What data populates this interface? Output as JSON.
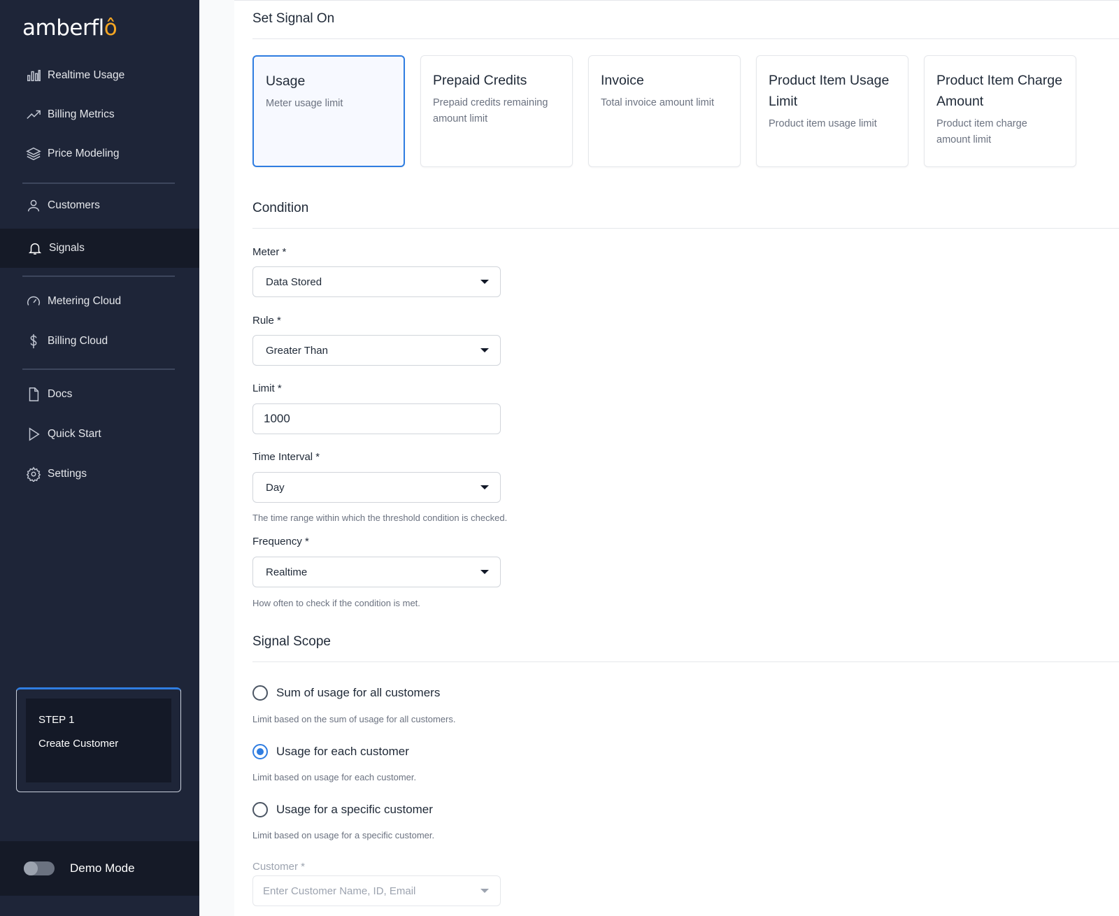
{
  "brand": {
    "logo_text_a": "amberfl",
    "logo_text_b": "ô",
    "accent": "#2f7de1",
    "logo_accent": "#f5a623"
  },
  "sidebar": {
    "items": [
      {
        "label": "Realtime Usage",
        "icon": "bar-chart-icon"
      },
      {
        "label": "Billing Metrics",
        "icon": "trend-line-icon"
      },
      {
        "label": "Price Modeling",
        "icon": "layers-icon"
      },
      {
        "label": "Customers",
        "icon": "user-icon"
      },
      {
        "label": "Signals",
        "icon": "bell-icon",
        "active": true
      },
      {
        "label": "Metering Cloud",
        "icon": "gauge-icon"
      },
      {
        "label": "Billing Cloud",
        "icon": "dollar-icon"
      },
      {
        "label": "Docs",
        "icon": "document-icon"
      },
      {
        "label": "Quick Start",
        "icon": "play-icon"
      },
      {
        "label": "Settings",
        "icon": "gear-icon"
      }
    ],
    "step": {
      "title": "STEP 1",
      "subtitle": "Create Customer"
    },
    "demo_mode": {
      "label": "Demo Mode",
      "enabled": false
    }
  },
  "form": {
    "set_signal_title": "Set Signal On",
    "cards": [
      {
        "title": "Usage",
        "desc": "Meter usage limit",
        "selected": true
      },
      {
        "title": "Prepaid Credits",
        "desc": "Prepaid credits remaining amount limit"
      },
      {
        "title": "Invoice",
        "desc": "Total invoice amount limit"
      },
      {
        "title": "Product Item Usage Limit",
        "desc": "Product item usage limit"
      },
      {
        "title": "Product Item Charge Amount",
        "desc": "Product item charge amount limit"
      }
    ],
    "condition_title": "Condition",
    "meter": {
      "label": "Meter *",
      "value": "Data Stored"
    },
    "rule": {
      "label": "Rule *",
      "value": "Greater Than"
    },
    "limit": {
      "label": "Limit *",
      "value": "1000"
    },
    "time_interval": {
      "label": "Time Interval *",
      "value": "Day",
      "help": "The time range within which the threshold condition is checked."
    },
    "frequency": {
      "label": "Frequency *",
      "value": "Realtime",
      "help": "How often to check if the condition is met."
    },
    "scope_title": "Signal Scope",
    "scope_options": [
      {
        "label": "Sum of usage for all customers",
        "help": "Limit based on the sum of usage for all customers.",
        "checked": false
      },
      {
        "label": "Usage for each customer",
        "help": "Limit based on usage for each customer.",
        "checked": true
      },
      {
        "label": "Usage for a specific customer",
        "help": "Limit based on usage for a specific customer.",
        "checked": false
      }
    ],
    "customer": {
      "label": "Customer *",
      "placeholder": "Enter Customer Name, ID, Email"
    }
  }
}
